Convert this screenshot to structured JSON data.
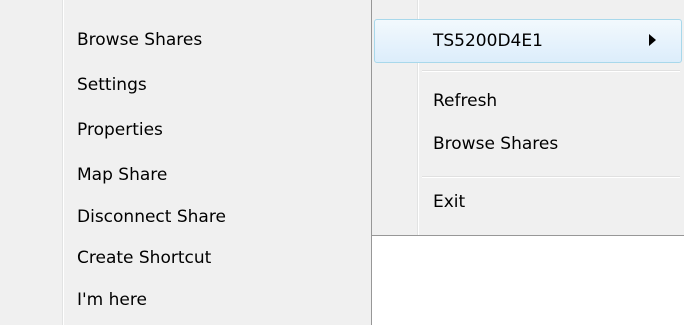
{
  "submenu": {
    "items": [
      {
        "label": "Browse Shares"
      },
      {
        "label": "Settings"
      },
      {
        "label": "Properties"
      },
      {
        "label": "Map Share"
      },
      {
        "label": "Disconnect Share"
      },
      {
        "label": "Create Shortcut"
      },
      {
        "label": "I'm here"
      }
    ]
  },
  "main_menu": {
    "device_label": "TS5200D4E1",
    "refresh_label": "Refresh",
    "browse_label": "Browse Shares",
    "exit_label": "Exit",
    "arrow_icon": "submenu-arrow-icon"
  },
  "colors": {
    "menu_background": "#f0f0f0",
    "highlight_border": "#a8d8eb",
    "highlight_fill": "#dcedfb"
  }
}
